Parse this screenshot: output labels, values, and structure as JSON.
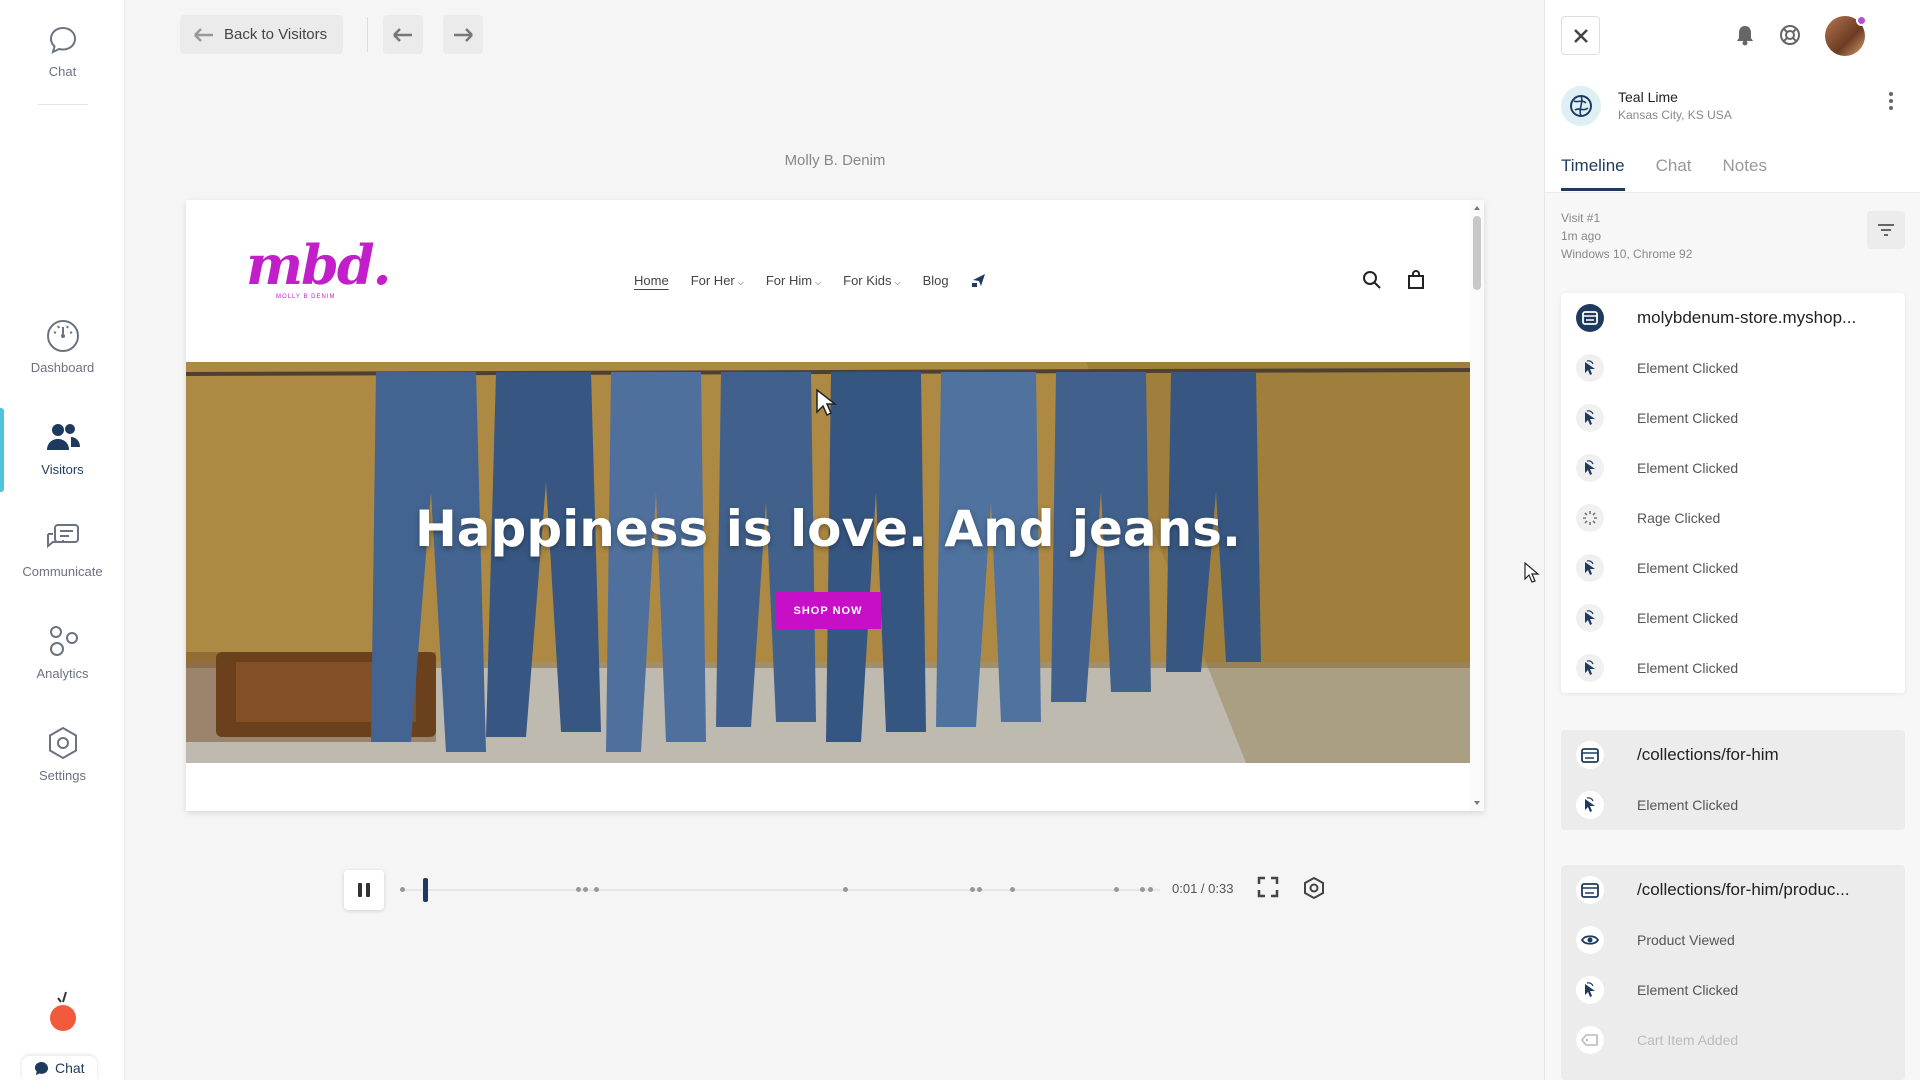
{
  "sidebar": {
    "top_chat_label": "Chat",
    "items": [
      {
        "label": "Dashboard"
      },
      {
        "label": "Visitors"
      },
      {
        "label": "Communicate"
      },
      {
        "label": "Analytics"
      },
      {
        "label": "Settings"
      }
    ],
    "bottom_chat_label": "Chat"
  },
  "toolbar": {
    "back_label": "Back to Visitors"
  },
  "replay": {
    "site_title": "Molly B. Denim",
    "site": {
      "logo_text": "mbd.",
      "logo_subtext": "MOLLY B DENIM",
      "nav": [
        "Home",
        "For Her",
        "For Him",
        "For Kids",
        "Blog"
      ],
      "hero_heading": "Happiness is love. And jeans.",
      "shop_button": "SHOP NOW"
    }
  },
  "player": {
    "time": "0:01 / 0:33",
    "progress_fraction": 0.03
  },
  "panel": {
    "visitor_name": "Teal Lime",
    "visitor_location": "Kansas City, KS USA",
    "tabs": [
      "Timeline",
      "Chat",
      "Notes"
    ],
    "visit": {
      "number": "Visit #1",
      "ago": "1m ago",
      "device": "Windows 10, Chrome 92"
    },
    "groups": [
      {
        "page": "molybdenum-store.myshop...",
        "events": [
          "Element Clicked",
          "Element Clicked",
          "Element Clicked",
          "Rage Clicked",
          "Element Clicked",
          "Element Clicked",
          "Element Clicked"
        ]
      },
      {
        "page": "/collections/for-him",
        "events": [
          "Element Clicked"
        ]
      },
      {
        "page": "/collections/for-him/produc...",
        "events": [
          "Product Viewed",
          "Element Clicked",
          "Cart Item Added"
        ]
      }
    ]
  },
  "colors": {
    "accent": "#1e3a5f",
    "active_bar": "#4ec3d9",
    "brand_magenta": "#c80fc8",
    "notification_dot": "#b44fd8"
  }
}
